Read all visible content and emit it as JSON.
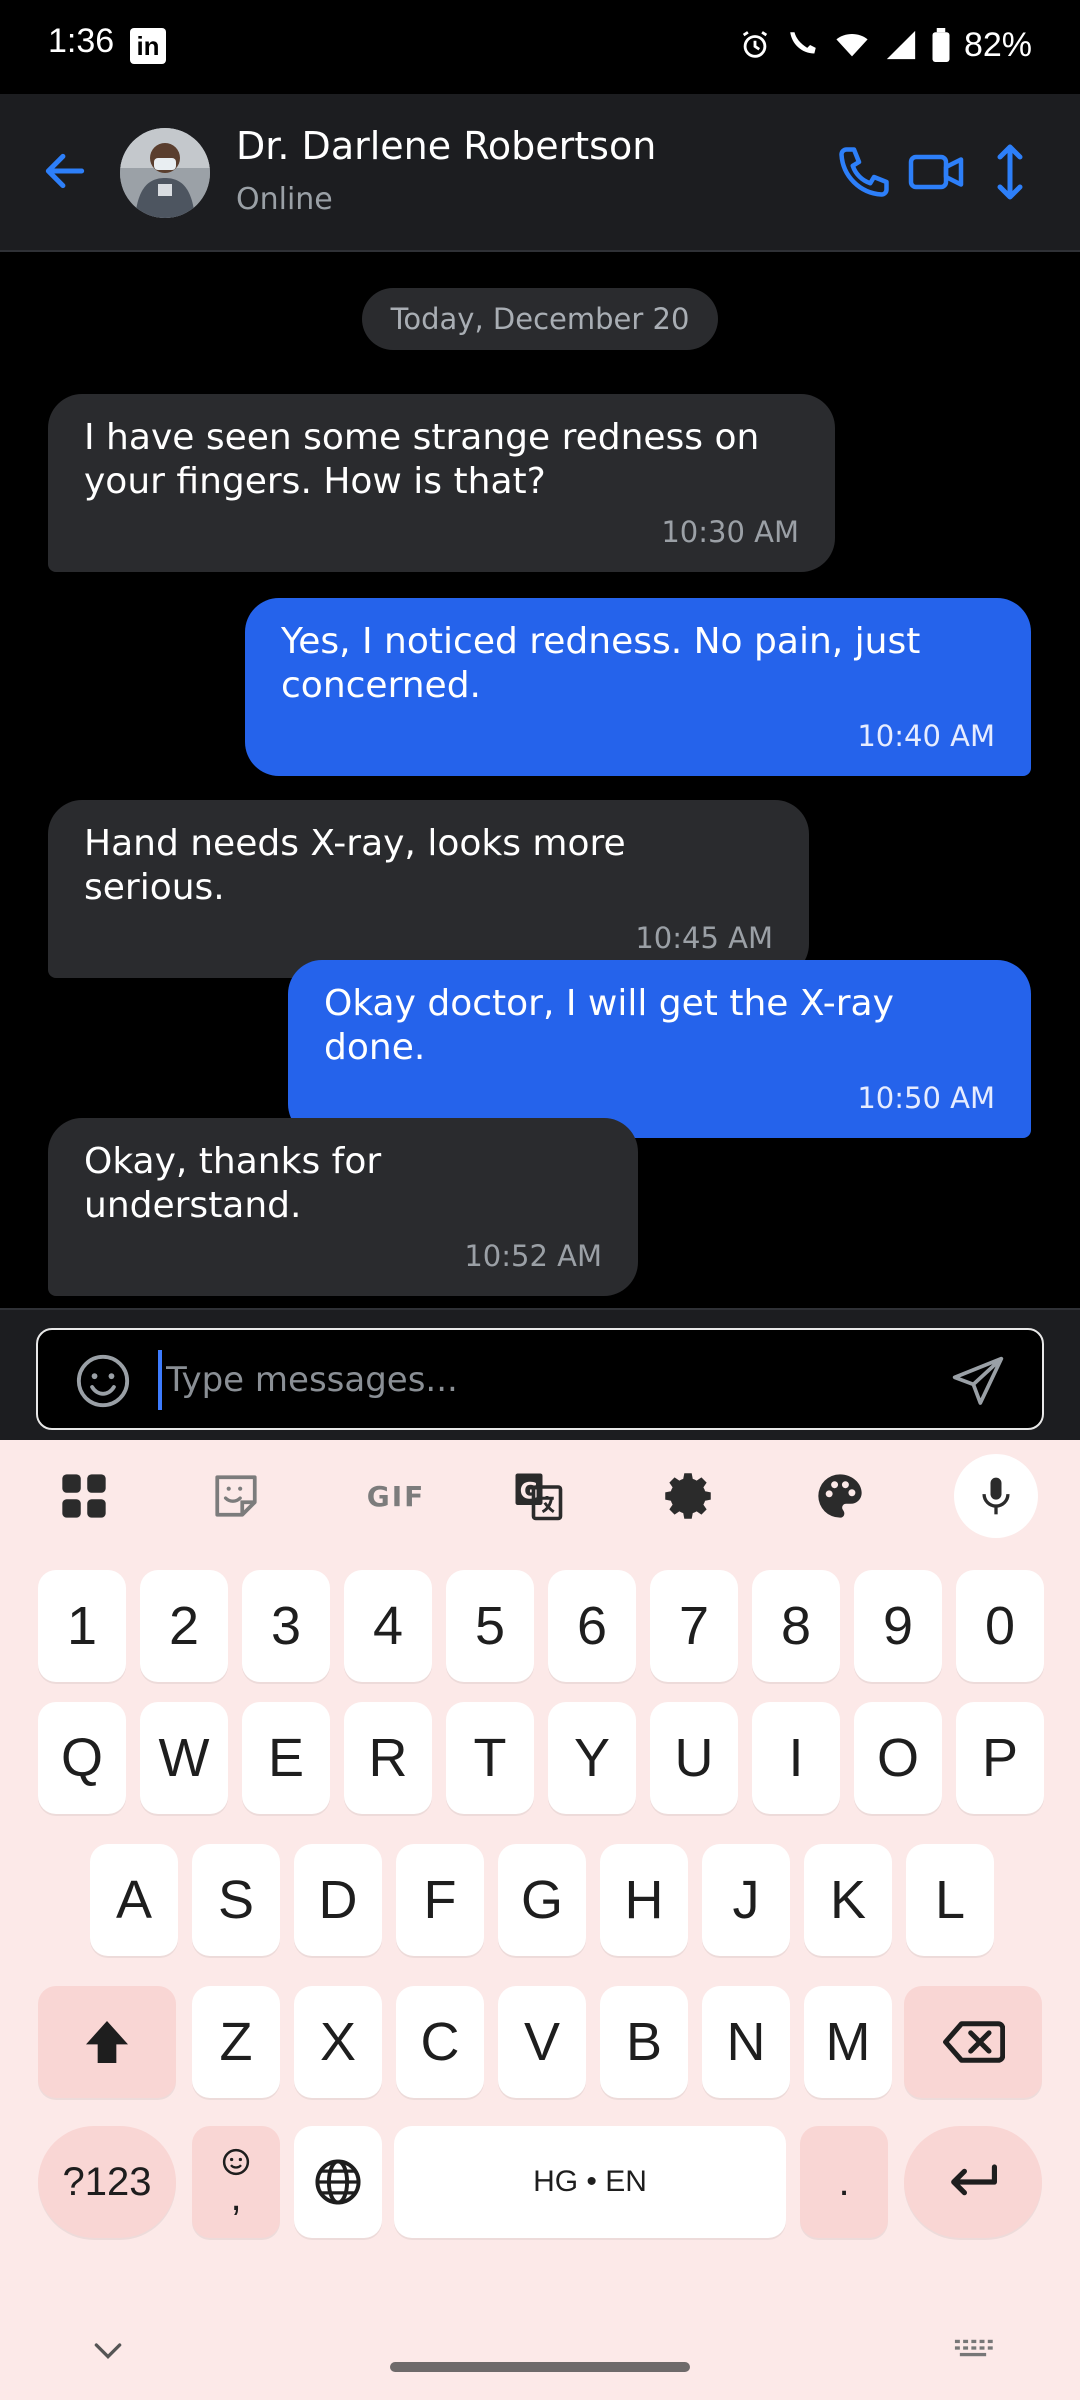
{
  "status_bar": {
    "time": "1:36",
    "app_badge": "in",
    "battery": "82%"
  },
  "header": {
    "contact_name": "Dr. Darlene Robertson",
    "contact_status": "Online",
    "accent_color": "#2d7ff9"
  },
  "chat": {
    "date_label": "Today, December 20",
    "messages": [
      {
        "direction": "incoming",
        "text": "I have seen some strange redness on your fingers. How is that?",
        "time": "10:30 AM"
      },
      {
        "direction": "outgoing",
        "text": "Yes, I noticed redness. No pain, just concerned.",
        "time": "10:40 AM"
      },
      {
        "direction": "incoming",
        "text": "Hand needs X-ray, looks more serious.",
        "time": "10:45 AM"
      },
      {
        "direction": "outgoing",
        "text": "Okay doctor, I will get the X-ray done.",
        "time": "10:50 AM"
      },
      {
        "direction": "incoming",
        "text": "Okay, thanks for understand.",
        "time": "10:52 AM"
      }
    ],
    "outgoing_color": "#2563eb",
    "incoming_color": "#2a2b2e"
  },
  "composer": {
    "placeholder": "Type messages..."
  },
  "keyboard": {
    "toolbar": [
      "apps-icon",
      "sticker-icon",
      "GIF",
      "translate-icon",
      "settings-icon",
      "palette-icon",
      "mic-icon"
    ],
    "gif_label": "GIF",
    "number_row": [
      "1",
      "2",
      "3",
      "4",
      "5",
      "6",
      "7",
      "8",
      "9",
      "0"
    ],
    "row1": [
      "Q",
      "W",
      "E",
      "R",
      "T",
      "Y",
      "U",
      "I",
      "O",
      "P"
    ],
    "row2": [
      "A",
      "S",
      "D",
      "F",
      "G",
      "H",
      "J",
      "K",
      "L"
    ],
    "row3": [
      "Z",
      "X",
      "C",
      "V",
      "B",
      "N",
      "M"
    ],
    "symbols_label": "?123",
    "emoji_comma_label": ",",
    "space_label": "HG • EN",
    "period_label": ".",
    "background_color": "#fce9e8"
  }
}
